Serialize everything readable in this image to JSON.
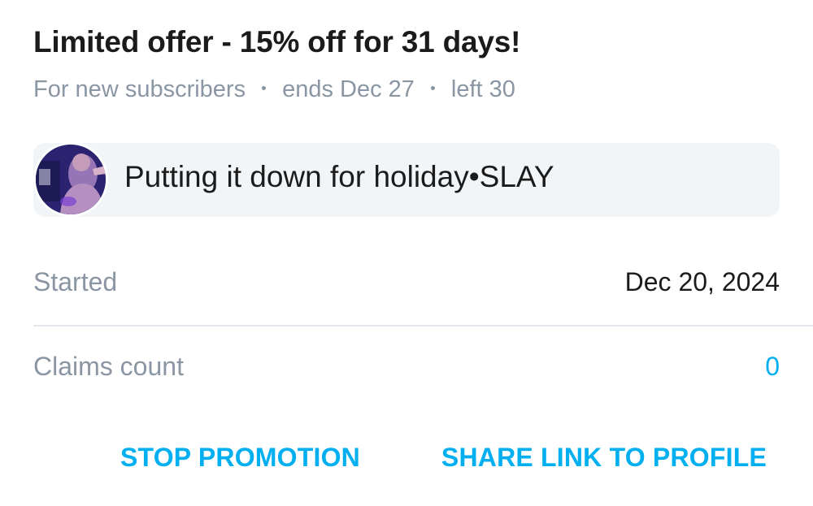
{
  "offer": {
    "title": "Limited offer - 15% off for 31 days!",
    "audience": "For new subscribers",
    "ends": "ends Dec 27",
    "left": "left 30"
  },
  "message": {
    "avatar_icon": "user-avatar-photo",
    "text": "Putting it down for holiday•SLAY"
  },
  "details": {
    "started_label": "Started",
    "started_value": "Dec 20, 2024",
    "claims_label": "Claims count",
    "claims_value": "0"
  },
  "actions": {
    "stop_label": "STOP PROMOTION",
    "share_label": "SHARE LINK TO PROFILE"
  },
  "colors": {
    "accent": "#00aff0",
    "muted": "#8a96a3",
    "message_bg": "#f2f5f7",
    "divider": "#e3e7eb"
  }
}
